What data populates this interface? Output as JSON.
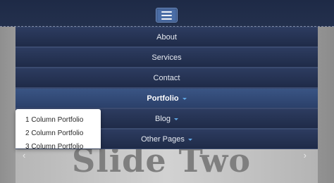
{
  "header": {
    "toggle_icon": "hamburger-icon"
  },
  "nav": {
    "items": [
      {
        "label": "About",
        "has_dropdown": false
      },
      {
        "label": "Services",
        "has_dropdown": false
      },
      {
        "label": "Contact",
        "has_dropdown": false
      },
      {
        "label": "Portfolio",
        "has_dropdown": true,
        "active": true
      },
      {
        "label": "Blog",
        "has_dropdown": true
      },
      {
        "label": "Other Pages",
        "has_dropdown": true
      }
    ]
  },
  "portfolio_dropdown": {
    "items": [
      "1 Column Portfolio",
      "2 Column Portfolio",
      "3 Column Portfolio"
    ]
  },
  "carousel": {
    "slide_title": "Slide Two",
    "prev_icon": "chevron-left-icon",
    "prev_glyph": "‹",
    "next_icon": "chevron-right-icon",
    "next_glyph": "›"
  },
  "colors": {
    "navbar_bg": "#1f2b48",
    "active_item_bg": "#2b406a",
    "caret": "#5fa6e4",
    "toggle_button": "#4a6da6"
  }
}
